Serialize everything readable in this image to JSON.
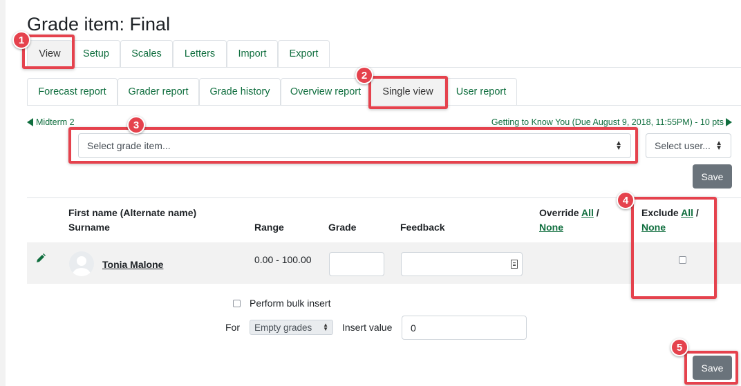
{
  "page_title": "Grade item: Final",
  "tabs_primary": [
    "View",
    "Setup",
    "Scales",
    "Letters",
    "Import",
    "Export"
  ],
  "tabs_secondary": [
    "Forecast report",
    "Grader report",
    "Grade history",
    "Overview report",
    "Single view",
    "User report"
  ],
  "nav": {
    "prev": "Midterm 2",
    "next": "Getting to Know You (Due August 9, 2018, 11:55PM) - 10 pts"
  },
  "select_grade_item": "Select grade item...",
  "select_user": "Select user...",
  "save_label": "Save",
  "table": {
    "col_name_line1": "First name (Alternate name)",
    "col_name_line2": "Surname",
    "col_range": "Range",
    "col_grade": "Grade",
    "col_feedback": "Feedback",
    "col_override": "Override",
    "col_exclude": "Exclude",
    "all": "All",
    "none": "None",
    "slash": "/",
    "row": {
      "name": "Tonia Malone",
      "range": "0.00 - 100.00"
    }
  },
  "bulk": {
    "checkbox_label": "Perform bulk insert",
    "for_label": "For",
    "for_option": "Empty grades",
    "insert_label": "Insert value",
    "insert_value": "0"
  },
  "badges": [
    "1",
    "2",
    "3",
    "4",
    "5"
  ],
  "colors": {
    "accent": "#0f6e3e",
    "highlight": "#e5424d",
    "button": "#6a737b"
  }
}
